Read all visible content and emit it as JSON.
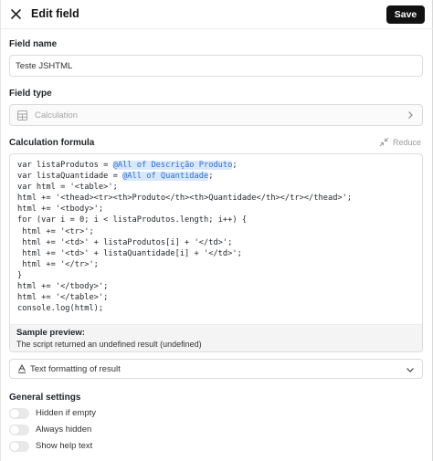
{
  "header": {
    "title": "Edit field",
    "save_label": "Save"
  },
  "field_name": {
    "label": "Field name",
    "value": "Teste JSHTML"
  },
  "field_type": {
    "label": "Field type",
    "value": "Calculation"
  },
  "formula": {
    "label": "Calculation formula",
    "reduce_label": "Reduce",
    "lines": [
      [
        {
          "t": "var listaProdutos = "
        },
        {
          "t": "@All of Descrição Produto",
          "ref": true
        },
        {
          "t": ";"
        }
      ],
      [
        {
          "t": "var listaQuantidade = "
        },
        {
          "t": "@All of Quantidade",
          "ref": true
        },
        {
          "t": ";"
        }
      ],
      [
        {
          "t": "var html = '<table>';"
        }
      ],
      [
        {
          "t": "html += '<thead><tr><th>Produto</th><th>Quantidade</th></tr></thead>';"
        }
      ],
      [
        {
          "t": "html += '<tbody>';"
        }
      ],
      [
        {
          "t": "for (var i = 0; i < listaProdutos.length; i++) {"
        }
      ],
      [
        {
          "t": " html += '<tr>';"
        }
      ],
      [
        {
          "t": " html += '<td>' + listaProdutos[i] + '</td>';"
        }
      ],
      [
        {
          "t": " html += '<td>' + listaQuantidade[i] + '</td>';"
        }
      ],
      [
        {
          "t": " html += '</tr>';"
        }
      ],
      [
        {
          "t": "}"
        }
      ],
      [
        {
          "t": "html += '</tbody>';"
        }
      ],
      [
        {
          "t": "html += '</table>';"
        }
      ],
      [
        {
          "t": "console.log(html);"
        }
      ]
    ],
    "preview_title": "Sample preview:",
    "preview_text": "The script returned an undefined result (undefined)"
  },
  "text_format": {
    "label": "Text formatting of result"
  },
  "general": {
    "label": "General settings",
    "toggles": [
      {
        "label": "Hidden if empty",
        "on": false
      },
      {
        "label": "Always hidden",
        "on": false
      },
      {
        "label": "Show help text",
        "on": false
      }
    ]
  },
  "colors": {
    "accent": "#2c6ed6",
    "token_bg": "#d8e8fb",
    "save_bg": "#111111"
  },
  "icons": {
    "close": "close-icon",
    "type": "table-icon",
    "chevron_right": "chevron-right-icon",
    "reduce": "collapse-arrows-icon",
    "format": "text-format-icon",
    "chevron_down": "chevron-down-icon"
  }
}
